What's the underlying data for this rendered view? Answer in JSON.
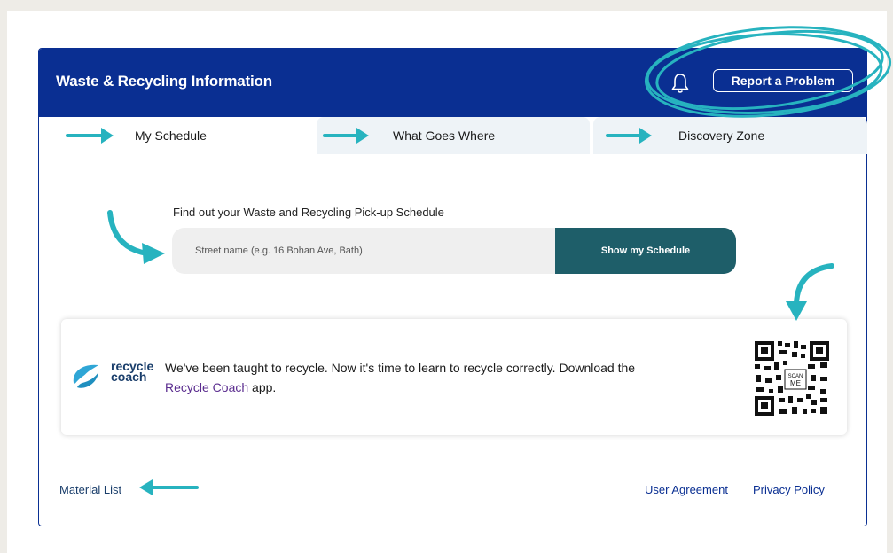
{
  "header": {
    "title": "Waste & Recycling Information",
    "report_label": "Report a Problem"
  },
  "tabs": [
    {
      "label": "My Schedule",
      "active": true
    },
    {
      "label": "What Goes Where",
      "active": false
    },
    {
      "label": "Discovery Zone",
      "active": false
    }
  ],
  "schedule": {
    "title": "Find out your Waste and Recycling Pick-up Schedule",
    "input_placeholder": "Street name (e.g. 16 Bohan Ave, Bath)",
    "button_label": "Show my Schedule"
  },
  "promo": {
    "logo_line1": "recycle",
    "logo_line2": "coach",
    "text": "We've been taught to recycle. Now it's time to learn to recycle correctly. Download the",
    "link_text": "Recycle Coach",
    "text_after": " app.",
    "qr_label_1": "SCAN",
    "qr_label_2": "ME"
  },
  "footer": {
    "material_list": "Material List",
    "user_agreement": "User Agreement",
    "privacy_policy": "Privacy Policy"
  },
  "colors": {
    "brand_blue": "#0a2f92",
    "button_teal": "#1e5e69",
    "annotation_teal": "#27b3bf"
  },
  "icons": [
    "bell-icon",
    "arrow-right-icon",
    "curved-arrow-icon",
    "qr-code-icon",
    "recycle-coach-logo"
  ]
}
